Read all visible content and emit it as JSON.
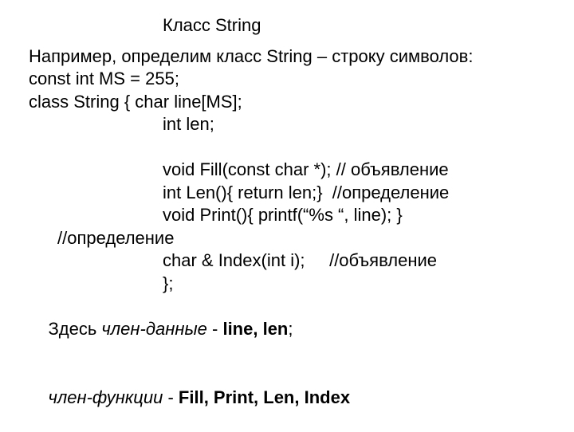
{
  "title": "Класс String",
  "l1": "Например, определим класс String – строку символов:",
  "l2": "const int MS = 255;",
  "l3": "class String { char line[MS];",
  "l4": "int len;",
  "l5": "void Fill(const char *); // объявление",
  "l6": "int Len(){ return len;}  //определение",
  "l7": "void Print(){ printf(“%s “, line); }",
  "l8": "//определение",
  "l9": "char & Index(int i);     //объявление",
  "l10": "};",
  "l11_prefix": "Здесь ",
  "l11_italic": "член-данные",
  "l11_mid": " - ",
  "l11_bold": "line, len",
  "l11_suffix": ";",
  "l12_italic": "член-функции",
  "l12_mid": " - ",
  "l12_bold": "Fill, Print, Len, Index"
}
